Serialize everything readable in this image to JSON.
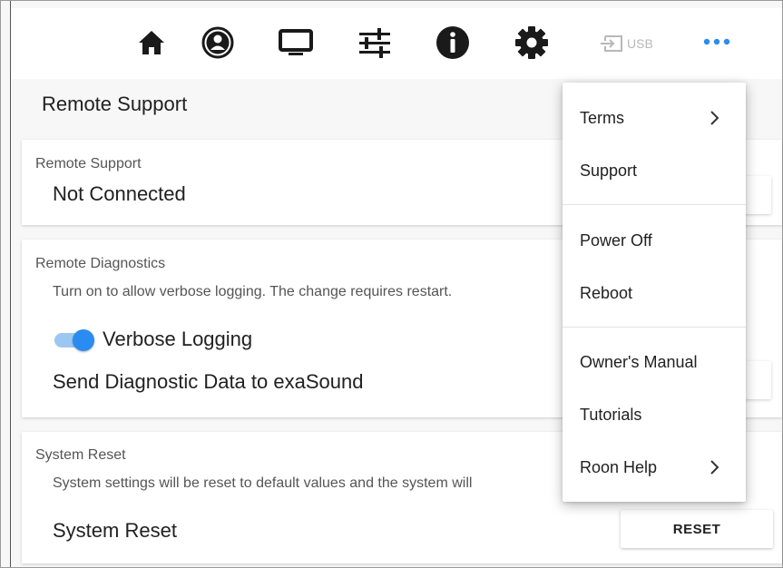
{
  "nav": {
    "icons": [
      "home-icon",
      "user-icon",
      "monitor-icon",
      "sliders-icon",
      "info-icon",
      "gear-icon"
    ],
    "usb_label": "USB"
  },
  "page_title": "Remote Support",
  "remote_support": {
    "caption": "Remote Support",
    "status": "Not Connected"
  },
  "remote_diagnostics": {
    "caption": "Remote Diagnostics",
    "description": "Turn on to allow verbose logging. The change requires restart.",
    "toggle_label": "Verbose Logging",
    "toggle_on": true,
    "send_label": "Send Diagnostic Data to exaSound"
  },
  "system_reset": {
    "caption": "System Reset",
    "description": "System settings will be reset to default values and the system will",
    "label": "System Reset",
    "button": "RESET"
  },
  "menu": {
    "terms": "Terms",
    "support": "Support",
    "power_off": "Power Off",
    "reboot": "Reboot",
    "owners_manual": "Owner's Manual",
    "tutorials": "Tutorials",
    "roon_help": "Roon Help"
  },
  "colors": {
    "accent": "#2a8cf0",
    "toggle_track": "#9cc7f2",
    "icon": "#1a1a1a",
    "usb_disabled": "#b8b8b8"
  }
}
